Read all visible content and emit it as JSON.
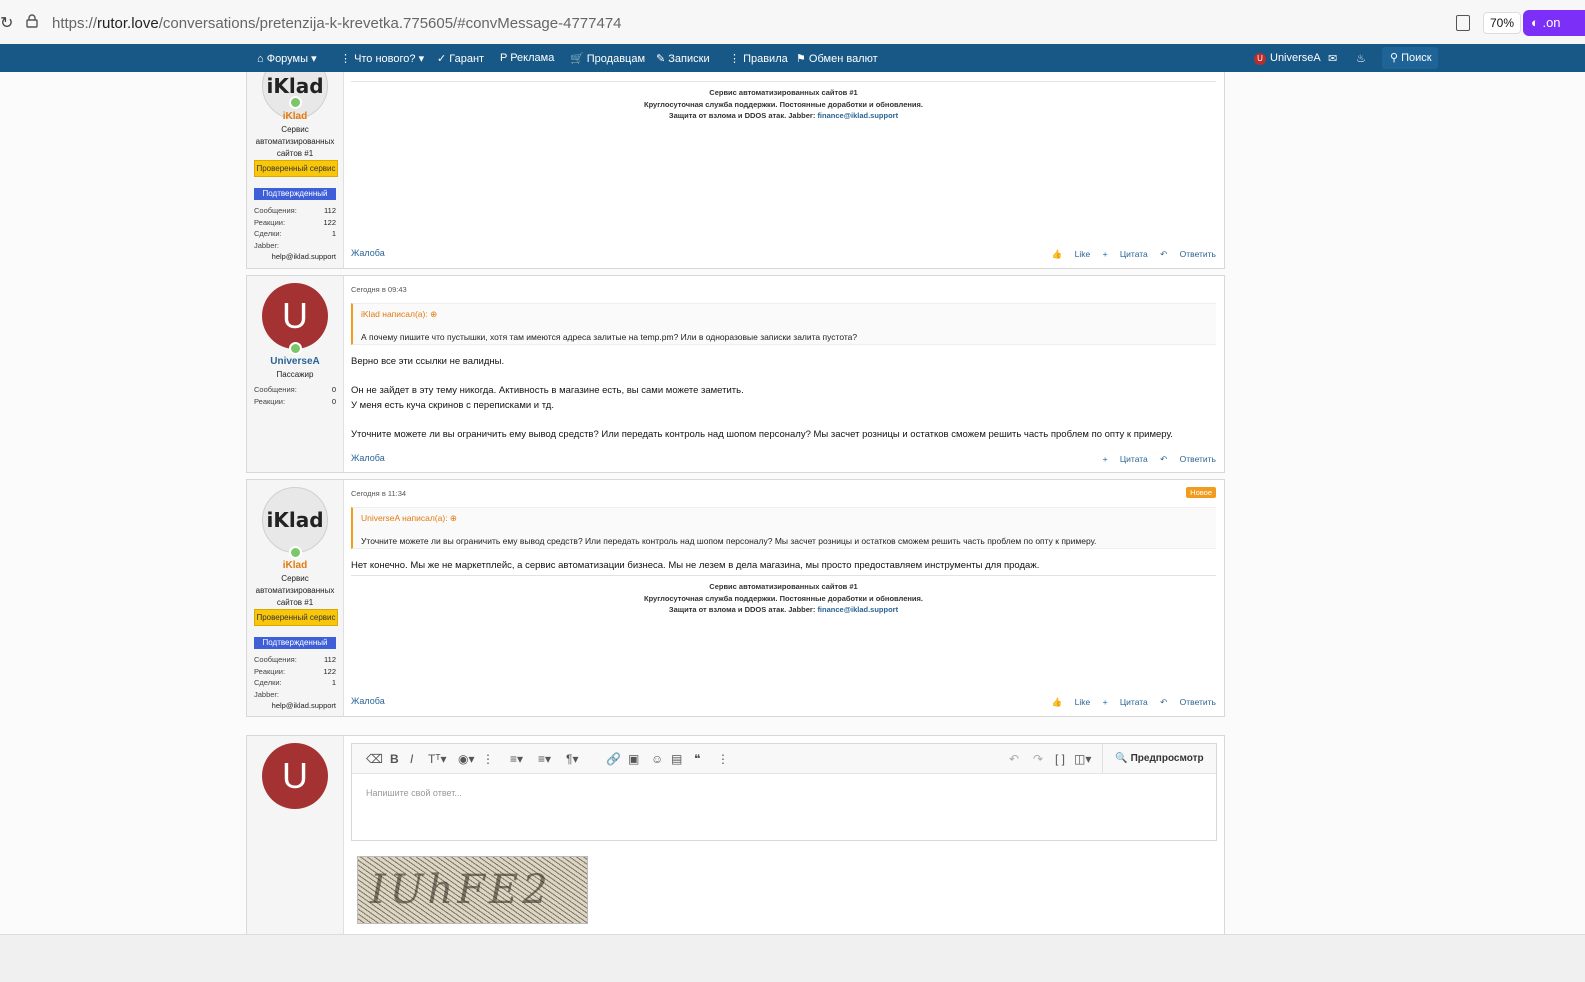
{
  "browser": {
    "url_prefix": "https://",
    "url_domain": "rutor.love",
    "url_path": "/conversations/pretenzija-k-krevetka.775605/#convMessage-4777474",
    "zoom": "70%",
    "ext_label": ".on"
  },
  "nav": {
    "items": [
      "Форумы",
      "Что нового?",
      "Гарант",
      "Реклама",
      "Продавцам",
      "Записки",
      "Правила",
      "Обмен валют"
    ],
    "user": "UniverseA",
    "avatar_letter": "U",
    "search": "Поиск"
  },
  "posts": [
    {
      "author": "iKlad",
      "logo": "iKlad",
      "user_title": "Сервис автоматизированных сайтов #1",
      "badge1": "Проверенный сервис",
      "badge2": "Подтвержденный",
      "stats": [
        {
          "label": "Сообщения:",
          "value": "112"
        },
        {
          "label": "Реакции:",
          "value": "122"
        },
        {
          "label": "Сделки:",
          "value": "1"
        }
      ],
      "jabber_label": "Jabber:",
      "jabber": "help@iklad.support",
      "sig": [
        "Сервис автоматизированных сайтов #1",
        "Круглосуточная служба поддержки. Постоянные доработки и обновления.",
        "Защита от взлома и DDOS атак. Jabber: "
      ],
      "sig_link": "finance@iklad.support",
      "report": "Жалоба",
      "like": "Like",
      "quote": "Цитата",
      "reply": "Ответить"
    },
    {
      "author": "UniverseA",
      "avatar_letter": "U",
      "user_title": "Пассажир",
      "stats": [
        {
          "label": "Сообщения:",
          "value": "0"
        },
        {
          "label": "Реакции:",
          "value": "0"
        }
      ],
      "date": "Сегодня в 09:43",
      "quote_head": "iKlad написал(а):",
      "quote_text": "А почему пишите что пустышки, хотя там имеются адреса залитые на temp.pm? Или в одноразовые записки залита пустота?",
      "body": [
        "Верно все эти ссылки не валидны.",
        "Он не зайдет в эту тему никогда. Активность в магазине есть, вы сами можете заметить.",
        "У меня есть куча скринов с переписками и тд.",
        "Уточните можете ли вы ограничить ему вывод средств? Или передать контроль над шопом персоналу? Мы засчет розницы и остатков сможем решить часть проблем по опту к примеру."
      ],
      "report": "Жалоба",
      "quote": "Цитата",
      "reply": "Ответить"
    },
    {
      "author": "iKlad",
      "logo": "iKlad",
      "user_title": "Сервис автоматизированных сайтов #1",
      "badge1": "Проверенный сервис",
      "badge2": "Подтвержденный",
      "stats": [
        {
          "label": "Сообщения:",
          "value": "112"
        },
        {
          "label": "Реакции:",
          "value": "122"
        },
        {
          "label": "Сделки:",
          "value": "1"
        }
      ],
      "jabber_label": "Jabber:",
      "jabber": "help@iklad.support",
      "date": "Сегодня в 11:34",
      "new_badge": "Новое",
      "quote_head": "UniverseA написал(а):",
      "quote_text": "Уточните можете ли вы ограничить ему вывод средств? Или передать контроль над шопом персоналу? Мы засчет розницы и остатков сможем решить часть проблем по опту к примеру.",
      "body": [
        "Нет конечно. Мы же не маркетплейс, а сервис автоматизации бизнеса. Мы не лезем в дела магазина, мы просто предоставляем инструменты для продаж."
      ],
      "sig": [
        "Сервис автоматизированных сайтов #1",
        "Круглосуточная служба поддержки. Постоянные доработки и обновления.",
        "Защита от взлома и DDOS атак. Jabber: "
      ],
      "sig_link": "finance@iklad.support",
      "report": "Жалоба",
      "like": "Like",
      "quote": "Цитата",
      "reply": "Ответить"
    }
  ],
  "editor": {
    "avatar_letter": "U",
    "placeholder": "Напишите свой ответ...",
    "preview": "Предпросмотр",
    "captcha_text": "IUhFE2"
  }
}
